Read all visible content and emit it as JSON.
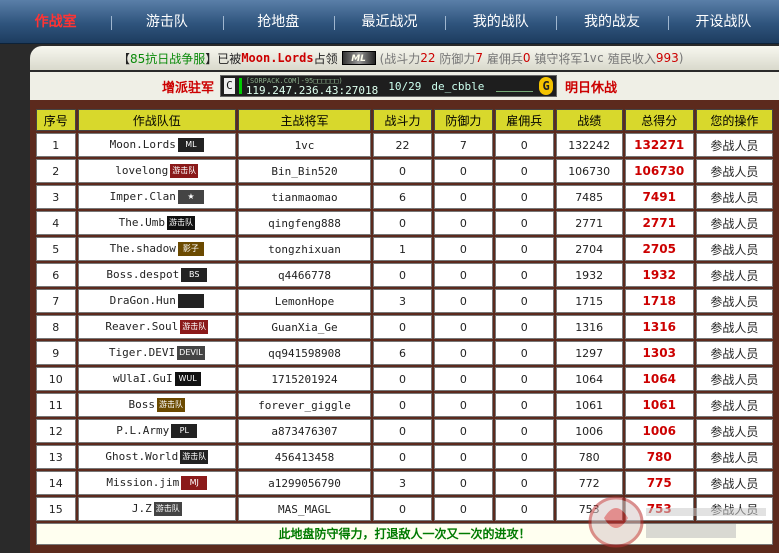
{
  "nav": [
    {
      "label": "作战室",
      "active": true
    },
    {
      "label": "游击队",
      "active": false
    },
    {
      "label": "抢地盘",
      "active": false
    },
    {
      "label": "最近战况",
      "active": false
    },
    {
      "label": "我的战队",
      "active": false
    },
    {
      "label": "我的战友",
      "active": false
    },
    {
      "label": "开设战队",
      "active": false
    }
  ],
  "status": {
    "bracket_open": "【",
    "server_name": "85抗日战争服",
    "bracket_close": "】已被",
    "occupier": "Moon.Lords",
    "occupied": "占领",
    "occupier_logo": "ML",
    "power_label": "(战斗力",
    "power": "22",
    "defense_label": "防御力",
    "defense": "7",
    "merc_label": "雇佣兵",
    "merc": "0",
    "general_label": "镇守将军",
    "general": "1vc",
    "income_label": "殖民收入",
    "income": "993",
    "close_paren": ")"
  },
  "server": {
    "reinforce": "增派驻军",
    "icon": "C",
    "title_small": "[SORPACK.COM]-95□□□□□□)",
    "address": "119.247.236.43:27018",
    "players": "10/29",
    "map": "de_cbble",
    "g_icon": "G",
    "next": "明日休战"
  },
  "table": {
    "headers": [
      "序号",
      "作战队伍",
      "主战将军",
      "战斗力",
      "防御力",
      "雇佣兵",
      "战绩",
      "总得分",
      "您的操作"
    ],
    "rows": [
      {
        "seq": "1",
        "team": "Moon.Lords",
        "logo": "ML",
        "general": "1vc",
        "power": "22",
        "defense": "7",
        "merc": "0",
        "record": "132242",
        "score": "132271",
        "op": "参战人员"
      },
      {
        "seq": "2",
        "team": "lovelong",
        "logo": "游击队",
        "general": "Bin_Bin520",
        "power": "0",
        "defense": "0",
        "merc": "0",
        "record": "106730",
        "score": "106730",
        "op": "参战人员"
      },
      {
        "seq": "3",
        "team": "Imper.Clan",
        "logo": "★",
        "general": "tianmaomao",
        "power": "6",
        "defense": "0",
        "merc": "0",
        "record": "7485",
        "score": "7491",
        "op": "参战人员"
      },
      {
        "seq": "4",
        "team": "The.Umb",
        "logo": "游击队",
        "general": "qingfeng888",
        "power": "0",
        "defense": "0",
        "merc": "0",
        "record": "2771",
        "score": "2771",
        "op": "参战人员"
      },
      {
        "seq": "5",
        "team": "The.shadow",
        "logo": "影子",
        "general": "tongzhixuan",
        "power": "1",
        "defense": "0",
        "merc": "0",
        "record": "2704",
        "score": "2705",
        "op": "参战人员"
      },
      {
        "seq": "6",
        "team": "Boss.despot",
        "logo": "BS",
        "general": "q4466778",
        "power": "0",
        "defense": "0",
        "merc": "0",
        "record": "1932",
        "score": "1932",
        "op": "参战人员"
      },
      {
        "seq": "7",
        "team": "DraGon.Hun",
        "logo": "",
        "general": "LemonHope",
        "power": "3",
        "defense": "0",
        "merc": "0",
        "record": "1715",
        "score": "1718",
        "op": "参战人员"
      },
      {
        "seq": "8",
        "team": "Reaver.Soul",
        "logo": "游击队",
        "general": "GuanXia_Ge",
        "power": "0",
        "defense": "0",
        "merc": "0",
        "record": "1316",
        "score": "1316",
        "op": "参战人员"
      },
      {
        "seq": "9",
        "team": "Tiger.DEVI",
        "logo": "DEVIL",
        "general": "qq941598908",
        "power": "6",
        "defense": "0",
        "merc": "0",
        "record": "1297",
        "score": "1303",
        "op": "参战人员"
      },
      {
        "seq": "10",
        "team": "wUlaI.GuI",
        "logo": "WUL",
        "general": "1715201924",
        "power": "0",
        "defense": "0",
        "merc": "0",
        "record": "1064",
        "score": "1064",
        "op": "参战人员"
      },
      {
        "seq": "11",
        "team": "Boss",
        "logo": "游击队",
        "general": "forever_giggle",
        "power": "0",
        "defense": "0",
        "merc": "0",
        "record": "1061",
        "score": "1061",
        "op": "参战人员"
      },
      {
        "seq": "12",
        "team": "P.L.Army",
        "logo": "PL",
        "general": "a873476307",
        "power": "0",
        "defense": "0",
        "merc": "0",
        "record": "1006",
        "score": "1006",
        "op": "参战人员"
      },
      {
        "seq": "13",
        "team": "Ghost.World",
        "logo": "游击队",
        "general": "456413458",
        "power": "0",
        "defense": "0",
        "merc": "0",
        "record": "780",
        "score": "780",
        "op": "参战人员"
      },
      {
        "seq": "14",
        "team": "Mission.jim",
        "logo": "MJ",
        "general": "a1299056790",
        "power": "3",
        "defense": "0",
        "merc": "0",
        "record": "772",
        "score": "775",
        "op": "参战人员"
      },
      {
        "seq": "15",
        "team": "J.Z",
        "logo": "游击队",
        "general": "MAS_MAGL",
        "power": "0",
        "defense": "0",
        "merc": "0",
        "record": "753",
        "score": "753",
        "op": "参战人员"
      }
    ]
  },
  "footer": "此地盘防守得力，打退敌人一次又一次的进攻！",
  "colors": {
    "accent_red": "#cc0000",
    "header_yellow": "#d8d82c",
    "frame_brown": "#5c2a1d",
    "nav_blue": "#2f547d"
  }
}
